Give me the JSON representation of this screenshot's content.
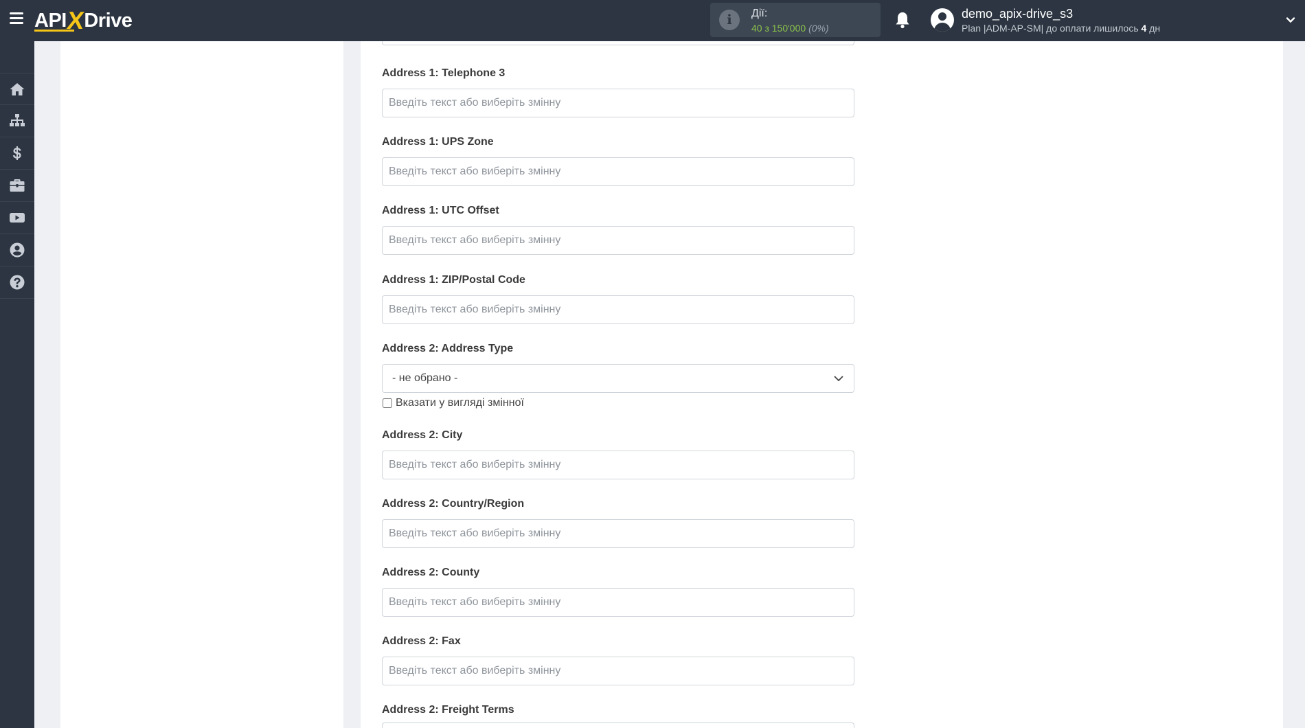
{
  "header": {
    "logo": {
      "api": "API",
      "x": "X",
      "drive": "Drive"
    },
    "actions": {
      "label": "Дії:",
      "count": "40 з 150'000",
      "percent": "(0%)"
    },
    "user": {
      "name": "demo_apix-drive_s3",
      "plan_prefix": "Plan |ADM-AP-SM| до оплати лишилось ",
      "days": "4",
      "days_suffix": " дн"
    }
  },
  "sidebar": {
    "items": [
      {
        "name": "home-icon"
      },
      {
        "name": "sitemap-icon"
      },
      {
        "name": "dollar-icon"
      },
      {
        "name": "briefcase-icon"
      },
      {
        "name": "youtube-icon"
      },
      {
        "name": "user-circle-icon"
      },
      {
        "name": "question-icon"
      }
    ]
  },
  "form": {
    "placeholder": "Введіть текст або виберіть змінну",
    "fields": [
      {
        "label": "Address 1: Telephone 3",
        "type": "text",
        "value": ""
      },
      {
        "label": "Address 1: UPS Zone",
        "type": "text",
        "value": ""
      },
      {
        "label": "Address 1: UTC Offset",
        "type": "text",
        "value": ""
      },
      {
        "label": "Address 1: ZIP/Postal Code",
        "type": "text",
        "value": ""
      },
      {
        "label": "Address 2: Address Type",
        "type": "select",
        "selected": "- не обрано -",
        "checkbox_label": "Вказати у вигляді змінної"
      },
      {
        "label": "Address 2: City",
        "type": "text",
        "value": ""
      },
      {
        "label": "Address 2: Country/Region",
        "type": "text",
        "value": ""
      },
      {
        "label": "Address 2: County",
        "type": "text",
        "value": ""
      },
      {
        "label": "Address 2: Fax",
        "type": "text",
        "value": ""
      },
      {
        "label": "Address 2: Freight Terms",
        "type": "text",
        "value": ""
      }
    ]
  }
}
